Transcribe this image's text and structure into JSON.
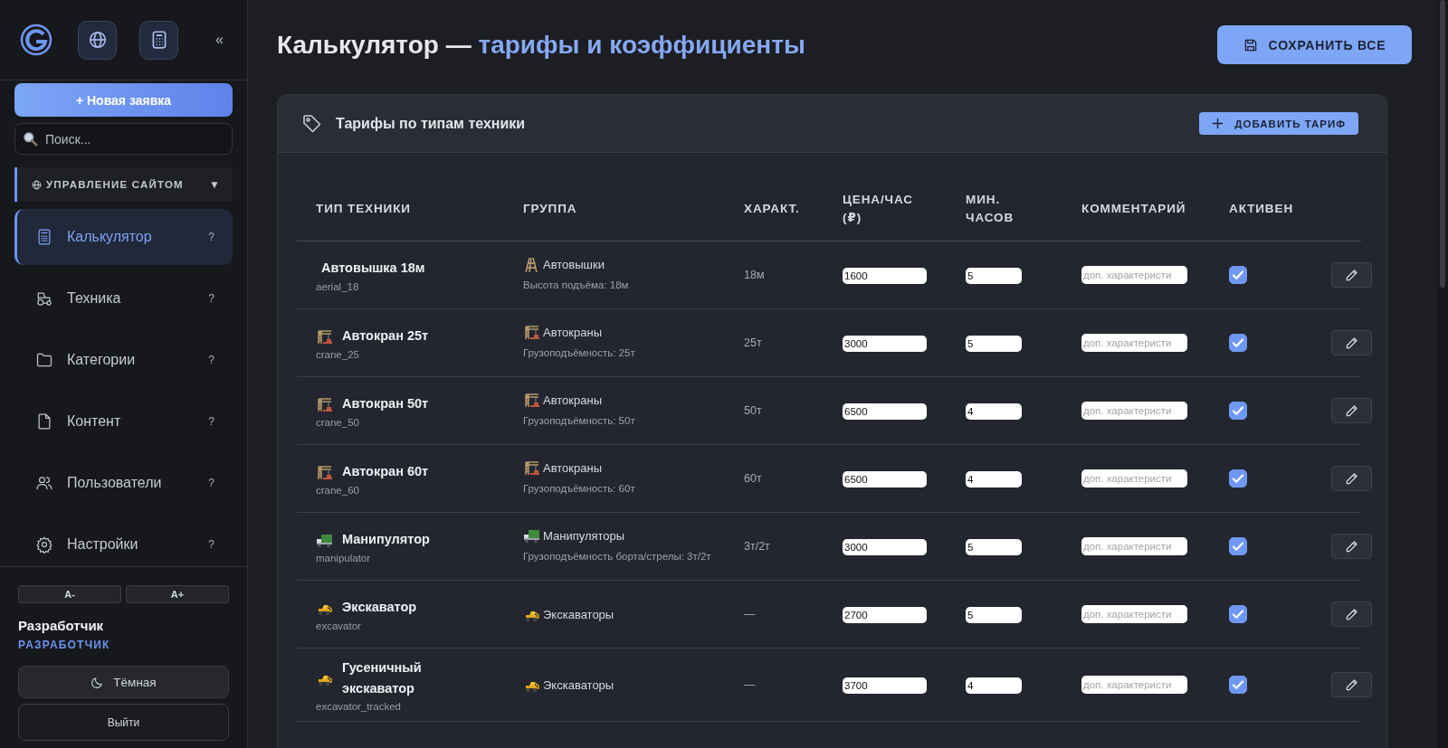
{
  "sidebar": {
    "collapse": "«",
    "new_request": "+ Новая заявка",
    "search": {
      "placeholder": "Поиск..."
    },
    "section": {
      "label": "УПРАВЛЕНИЕ САЙТОМ",
      "caret": "▼",
      "expanded": true
    },
    "items": [
      {
        "kind": "calculator",
        "label": "Калькулятор",
        "hint": "?",
        "selected": true
      },
      {
        "kind": "tractor",
        "label": "Техника",
        "hint": "?",
        "selected": false
      },
      {
        "kind": "folder",
        "label": "Категории",
        "hint": "?",
        "selected": false
      },
      {
        "kind": "file",
        "label": "Контент",
        "hint": "?",
        "selected": false
      },
      {
        "kind": "users",
        "label": "Пользователи",
        "hint": "?",
        "selected": false
      },
      {
        "kind": "gear",
        "label": "Настройки",
        "hint": "?",
        "selected": false
      }
    ],
    "font_buttons": [
      "A-",
      "A+"
    ],
    "user": {
      "name": "Разработчик",
      "role": "РАЗРАБОТЧИК"
    },
    "theme_button": "Тёмная",
    "logout": "Выйти"
  },
  "header": {
    "title": "Калькулятор — ",
    "title_accent": "тарифы и коэффициенты",
    "save_button": "СОХРАНИТЬ ВСЕ"
  },
  "card": {
    "title": "Тарифы по типам техники",
    "add_button": "ДОБАВИТЬ ТАРИФ",
    "table": {
      "columns": [
        "ТИП ТЕХНИКИ",
        "ГРУППА",
        "ХАРАКТ.",
        "ЦЕНА/ЧАС (₽)",
        "МИН. ЧАСОВ",
        "КОММЕНТАРИЙ",
        "АКТИВЕН"
      ],
      "rows": [
        {
          "kind": "aerial",
          "name": "Автовышка 18м",
          "code": "aerial_18",
          "group": "Автовышки",
          "note": "Высота подъёма: 18м",
          "spec": "18м",
          "price": "1600",
          "min_hours": "5",
          "comment_placeholder": "доп. характеристи",
          "active": true
        },
        {
          "kind": "crane",
          "name": "Автокран 25т",
          "code": "crane_25",
          "group": "Автокраны",
          "note": "Грузоподъёмность: 25т",
          "spec": "25т",
          "price": "3000",
          "min_hours": "5",
          "comment_placeholder": "доп. характеристи",
          "active": true
        },
        {
          "kind": "crane",
          "name": "Автокран 50т",
          "code": "crane_50",
          "group": "Автокраны",
          "note": "Грузоподъёмность: 50т",
          "spec": "50т",
          "price": "6500",
          "min_hours": "4",
          "comment_placeholder": "доп. характеристи",
          "active": true
        },
        {
          "kind": "crane",
          "name": "Автокран 60т",
          "code": "crane_60",
          "group": "Автокраны",
          "note": "Грузоподъёмность: 60т",
          "spec": "60т",
          "price": "6500",
          "min_hours": "4",
          "comment_placeholder": "доп. характеристи",
          "active": true
        },
        {
          "kind": "manipulator",
          "name": "Манипулятор",
          "code": "manipulator",
          "group": "Манипуляторы",
          "note": "Грузоподъёмность борта/стрелы: 3т/2т",
          "spec": "3т/2т",
          "price": "3000",
          "min_hours": "5",
          "comment_placeholder": "доп. характеристи",
          "active": true
        },
        {
          "kind": "excavator",
          "name": "Экскаватор",
          "code": "excavator",
          "group": "Экскаваторы",
          "spec": "—",
          "price": "2700",
          "min_hours": "5",
          "comment_placeholder": "доп. характеристи",
          "active": true
        },
        {
          "kind": "excavator",
          "name": "Гусеничный экскаватор",
          "code": "excavator_tracked",
          "group": "Экскаваторы",
          "spec": "—",
          "price": "3700",
          "min_hours": "4",
          "comment_placeholder": "доп. характеристи",
          "active": true
        }
      ]
    }
  }
}
